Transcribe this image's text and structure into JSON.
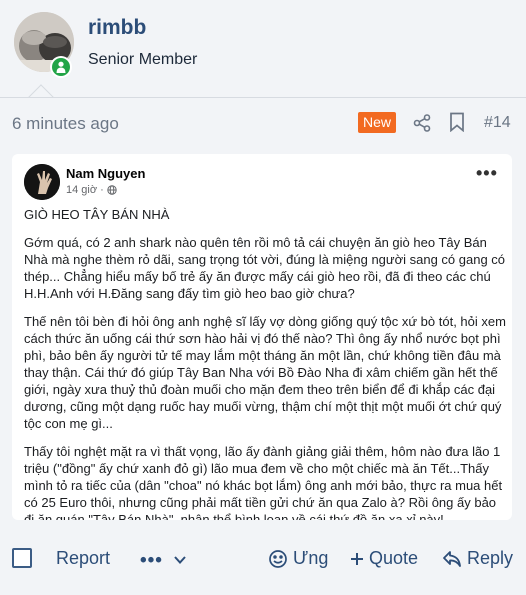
{
  "author": {
    "username": "rimbb",
    "title": "Senior Member"
  },
  "meta": {
    "time": "6 minutes ago",
    "badge": "New",
    "post_number": "#14"
  },
  "embed": {
    "name": "Nam Nguyen",
    "time": "14 giờ ·",
    "paragraphs": [
      "GIÒ HEO TÂY BÁN NHÀ",
      "Gớm quá, có 2 anh shark nào quên tên rồi mô tả cái chuyện ăn giò heo Tây Bán Nhà mà nghe thèm rỏ dãi, sang trọng tót vời, đúng là miệng người sang có gang có thép... Chẳng hiểu mấy bố trẻ ấy ăn được mấy cái giò heo rồi, đã đi theo các chú H.H.Anh với H.Đăng sang đấy tìm giò heo bao giờ chưa?",
      "Thế nên tôi bèn đi hỏi ông anh nghệ sĩ lấy vợ dòng giống quý tộc xứ bò tót, hỏi xem cách thức ăn uống cái thứ sơn hào hải vị đó thế nào? Thì ông ấy nhổ nước bọt phì phì, bảo bên ấy người tử tế may lắm một tháng ăn một lần, chứ không tiền đâu mà thay thận. Cái thứ đó giúp Tây Ban Nha với Bồ Đào Nha đi xâm chiếm gần hết thế giới, ngày xưa thuỷ thủ đoàn muối cho mặn đem theo trên biển để đi khắp các đại dương, cũng một dạng ruốc hay muối vừng, thậm chí một thịt một muối ớt chứ quý tộc con mẹ gì...",
      "Thấy tôi nghệt mặt ra vì thất vọng, lão ấy đành giảng giải thêm, hôm nào đưa lão 1 triệu (\"đồng\" ấy chứ xanh đỏ gì) lão mua đem về cho một chiếc mà ăn Tết...Thấy mình tỏ ra tiếc của (dân \"choa\" nó khác bọt lắm) ông anh mới bảo, thực ra mua hết có 25 Euro thôi, nhưng cũng phải mất tiền gửi chứ ăn qua Zalo à? Rồi ông ấy bảo đi ăn quán \"Tây Bán Nhà\", nhân thể bình loạn về cái thứ đồ ăn xa xỉ này!"
    ]
  },
  "actions": {
    "report": "Report",
    "dots": "•••",
    "react": "Ưng",
    "quote": "Quote",
    "reply": "Reply"
  },
  "colors": {
    "accent": "#2c4d78",
    "badge": "#f26a21",
    "online": "#22a447",
    "background": "#f2f4f7"
  },
  "icons": [
    "online-status-icon",
    "share-icon",
    "bookmark-icon",
    "globe-icon",
    "more-dots-icon",
    "checkbox",
    "chevron-down-icon",
    "react-face-icon",
    "plus-icon",
    "reply-arrow-icon"
  ]
}
